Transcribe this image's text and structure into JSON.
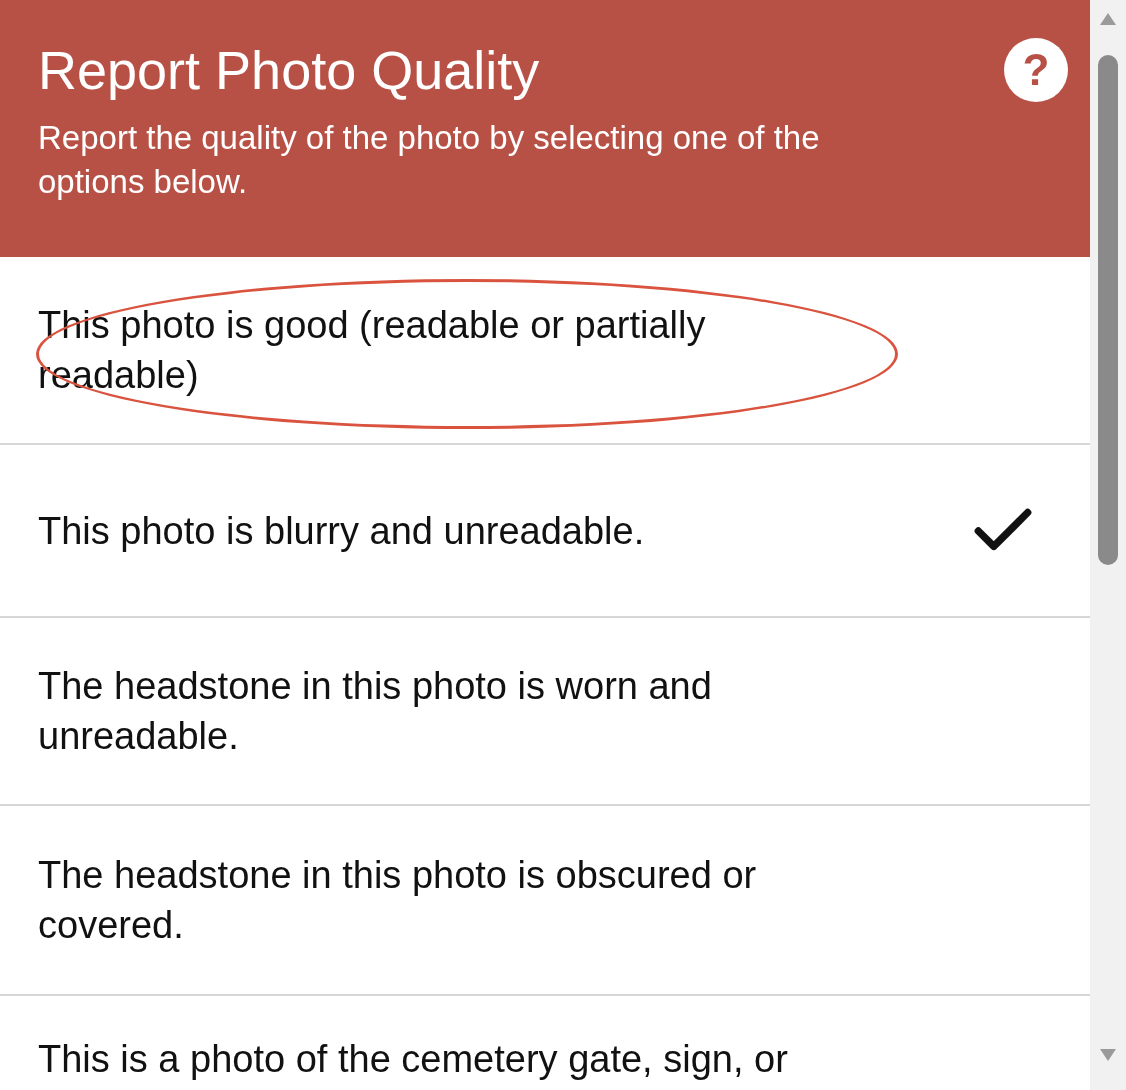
{
  "header": {
    "title": "Report Photo Quality",
    "subtitle": "Report the quality of the photo by selecting one of the options below.",
    "help_button": {
      "label": "?"
    }
  },
  "options": [
    {
      "label": "This photo is good (readable or partially readable)",
      "selected": false,
      "circled": true
    },
    {
      "label": "This photo is blurry and unreadable.",
      "selected": true,
      "circled": false
    },
    {
      "label": "The headstone in this photo is worn and unreadable.",
      "selected": false,
      "circled": false
    },
    {
      "label": "The headstone in this photo is obscured or covered.",
      "selected": false,
      "circled": false
    },
    {
      "label": "This is a photo of the cemetery gate, sign, or",
      "selected": false,
      "circled": false
    }
  ]
}
